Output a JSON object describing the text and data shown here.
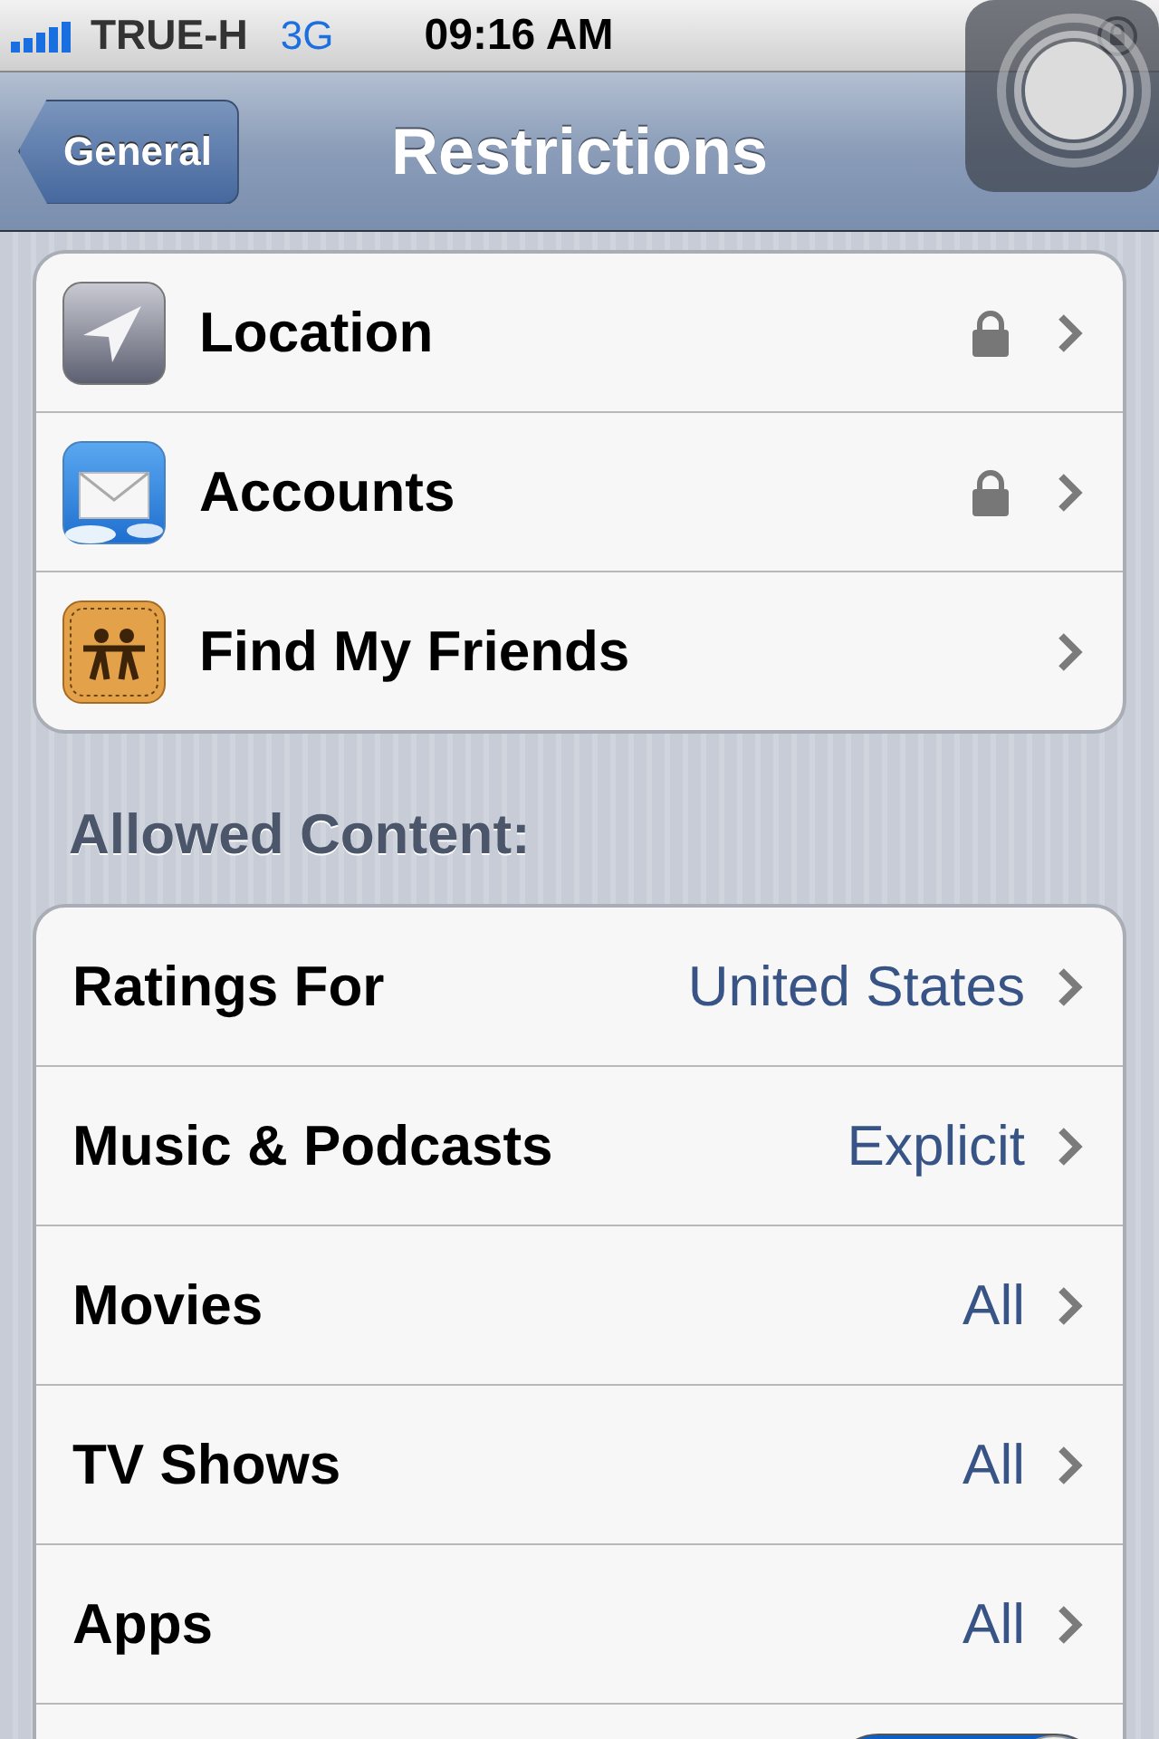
{
  "status_bar": {
    "carrier": "TRUE-H",
    "network": "3G",
    "time": "09:16 AM"
  },
  "nav_bar": {
    "back": "General",
    "title": "Restrictions"
  },
  "privacy": [
    {
      "label": "Location",
      "locked": true
    },
    {
      "label": "Accounts",
      "locked": true
    },
    {
      "label": "Find My Friends",
      "locked": false
    }
  ],
  "allowed_content": {
    "header": "Allowed Content:",
    "rows": [
      {
        "kind": "value",
        "label": "Ratings For",
        "value": "United States"
      },
      {
        "kind": "value",
        "label": "Music & Podcasts",
        "value": "Explicit"
      },
      {
        "kind": "value",
        "label": "Movies",
        "value": "All"
      },
      {
        "kind": "value",
        "label": "TV Shows",
        "value": "All"
      },
      {
        "kind": "value",
        "label": "Apps",
        "value": "All"
      },
      {
        "kind": "toggle",
        "on": true
      }
    ]
  }
}
